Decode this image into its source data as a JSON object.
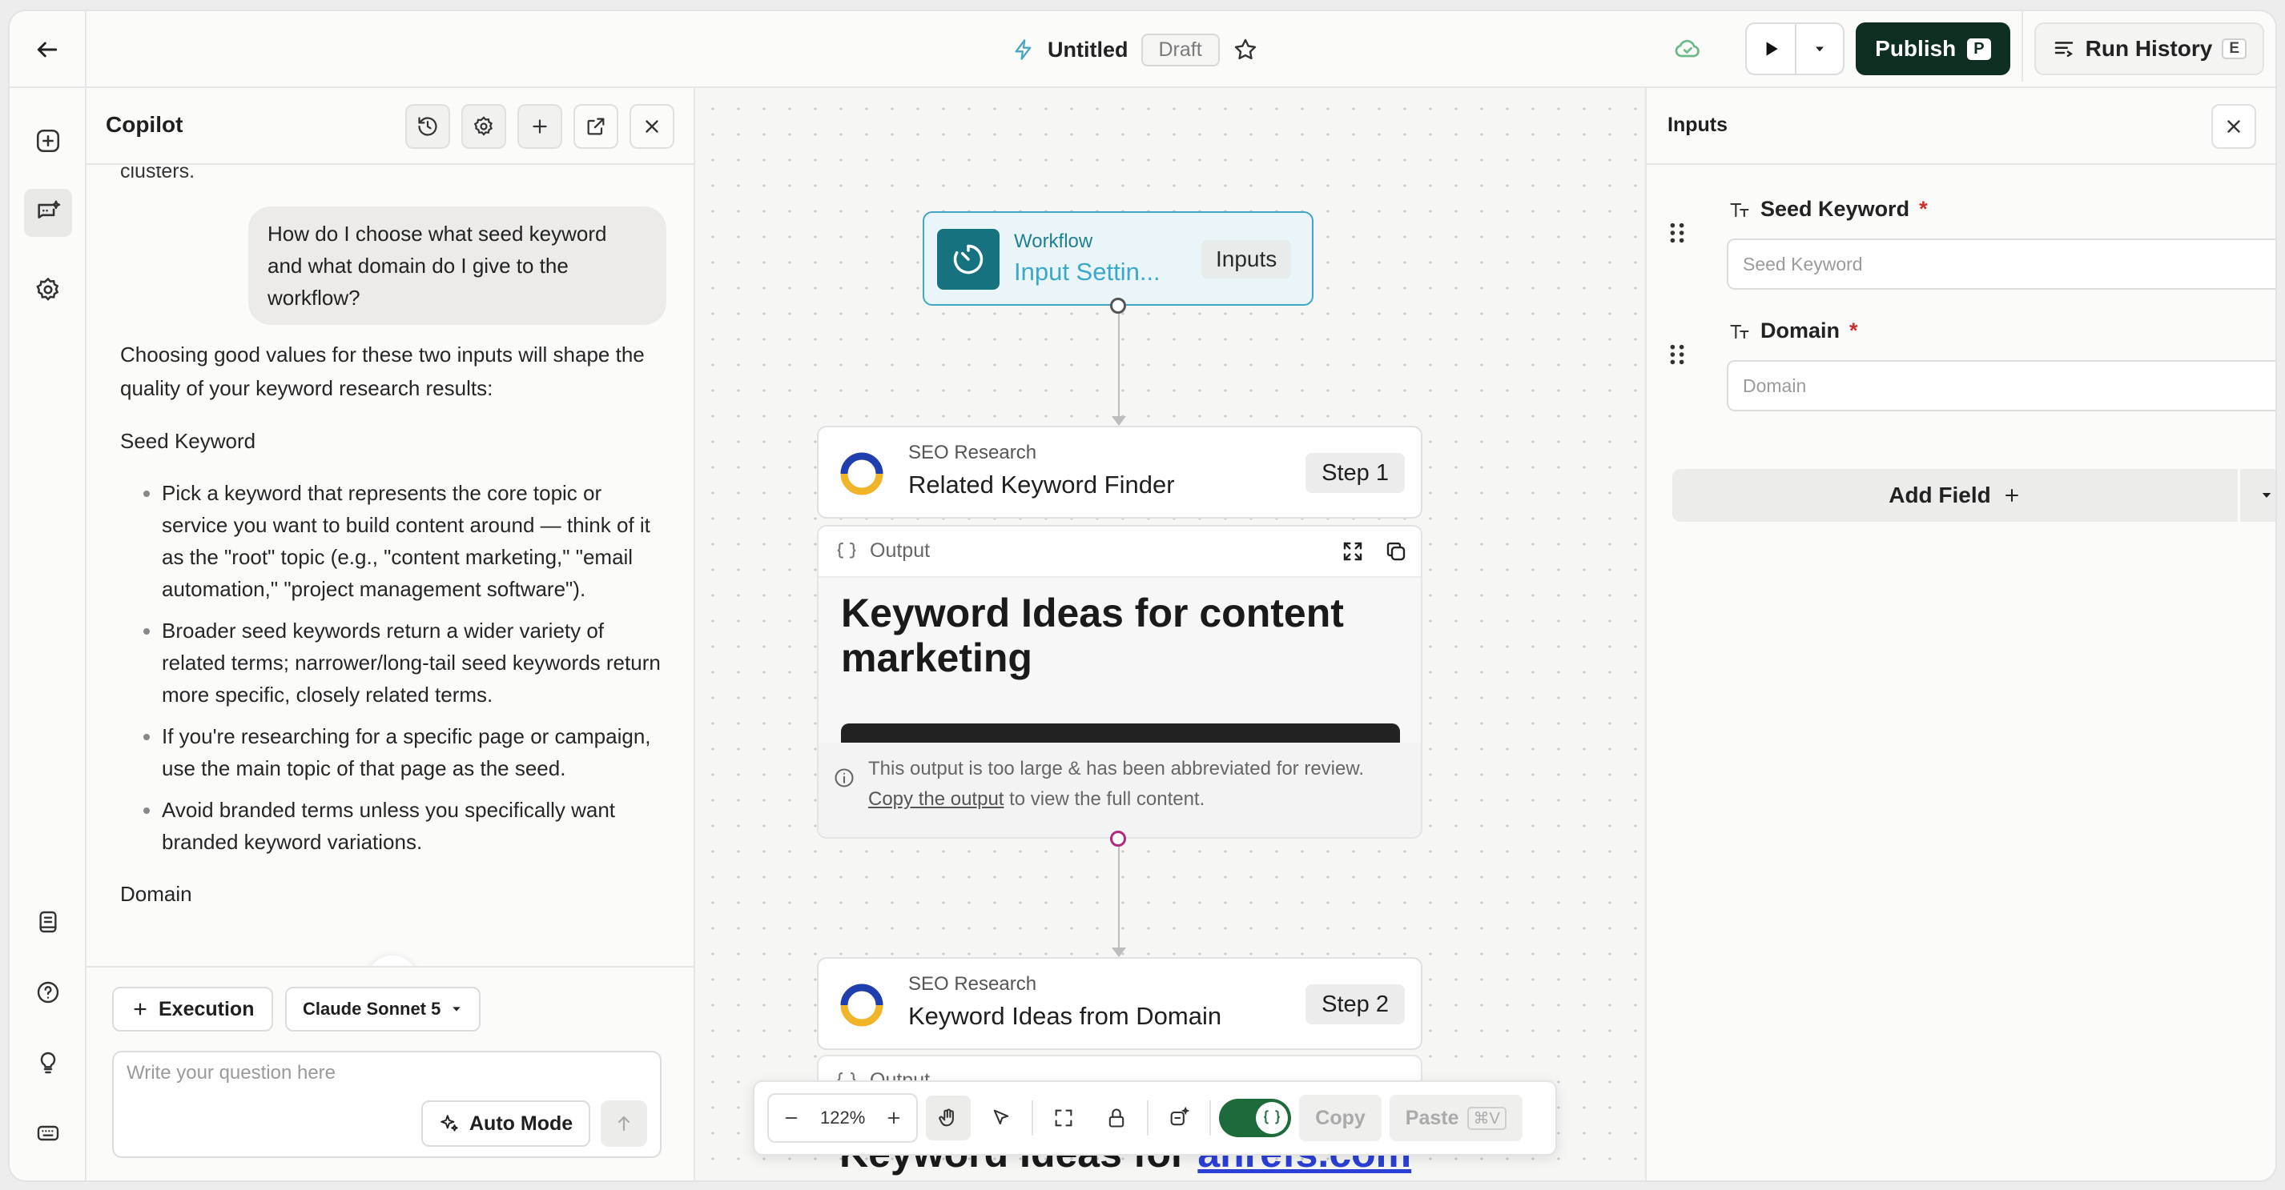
{
  "header": {
    "title": "Untitled",
    "status_badge": "Draft",
    "publish_label": "Publish",
    "publish_shortcut": "P",
    "run_history_label": "Run History",
    "run_history_shortcut": "E"
  },
  "copilot": {
    "title": "Copilot",
    "clipped_text": "clusters.",
    "user_message": "How do I choose what seed keyword and what domain do I give to the workflow?",
    "reply_intro": "Choosing good values for these two inputs will shape the quality of your keyword research results:",
    "section_seed": "Seed Keyword",
    "seed_bullets": [
      "Pick a keyword that represents the core topic or service you want to build content around — think of it as the \"root\" topic (e.g., \"content marketing,\" \"email automation,\" \"project management software\").",
      "Broader seed keywords return a wider variety of related terms; narrower/long-tail seed keywords return more specific, closely related terms.",
      "If you're researching for a specific page or campaign, use the main topic of that page as the seed.",
      "Avoid branded terms unless you specifically want branded keyword variations."
    ],
    "section_domain": "Domain",
    "execution_label": "Execution",
    "model_label": "Claude Sonnet 5",
    "input_placeholder": "Write your question here",
    "auto_mode_label": "Auto Mode"
  },
  "canvas": {
    "input_node": {
      "kind": "Workflow",
      "title": "Input Settin...",
      "tag": "Inputs"
    },
    "step1": {
      "kind": "SEO Research",
      "title": "Related Keyword Finder",
      "step": "Step 1"
    },
    "output1": {
      "label": "Output",
      "heading": "Keyword Ideas for content marketing",
      "note": "This output is too large & has been abbreviated for review.",
      "note_link": "Copy the output",
      "note_tail": "to view the full content."
    },
    "step2": {
      "kind": "SEO Research",
      "title": "Keyword Ideas from Domain",
      "step": "Step 2"
    },
    "output2": {
      "label": "Output",
      "heading_prefix": "Keyword Ideas for",
      "heading_link": "ahrefs.com"
    },
    "toolbar": {
      "zoom": "122%",
      "copy_label": "Copy",
      "paste_label": "Paste",
      "paste_shortcut": "⌘V"
    }
  },
  "inputs_panel": {
    "title": "Inputs",
    "fields": [
      {
        "label": "Seed Keyword",
        "required": "*",
        "placeholder": "Seed Keyword"
      },
      {
        "label": "Domain",
        "required": "*",
        "placeholder": "Domain"
      }
    ],
    "add_field_label": "Add Field"
  },
  "colors": {
    "publish_bg": "#0f2e22",
    "node_accent": "#41a5c6",
    "toggle_on": "#1d6b3b",
    "required": "#d12b2b"
  }
}
